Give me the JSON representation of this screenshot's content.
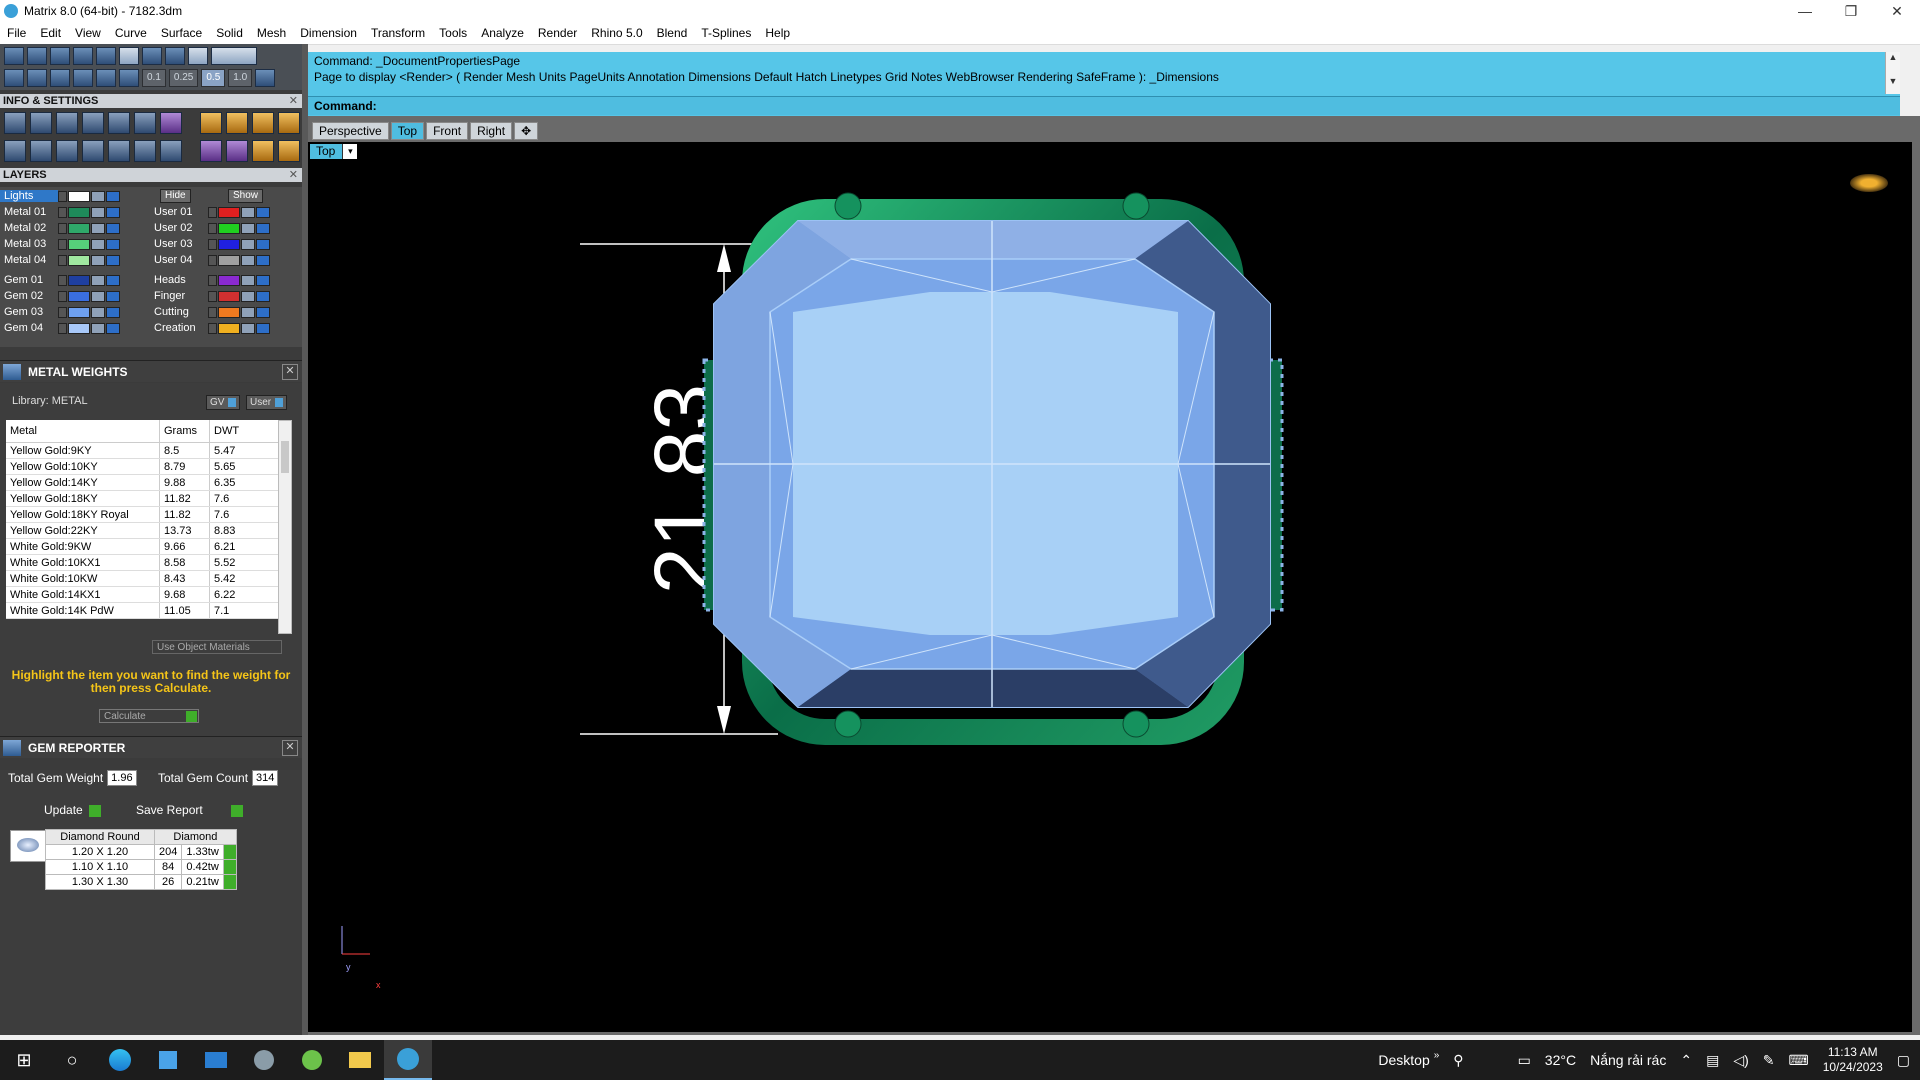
{
  "window": {
    "title": "Matrix 8.0 (64-bit) - 7182.3dm",
    "minimize": "—",
    "maximize": "❐",
    "close": "✕"
  },
  "menu": [
    "File",
    "Edit",
    "View",
    "Curve",
    "Surface",
    "Solid",
    "Mesh",
    "Dimension",
    "Transform",
    "Tools",
    "Analyze",
    "Render",
    "Rhino 5.0",
    "Blend",
    "T-Splines",
    "Help"
  ],
  "toolbar": {
    "snap_values": [
      "0.1",
      "0.25",
      "0.5",
      "1.0"
    ]
  },
  "info_settings": {
    "title": "INFO & SETTINGS",
    "close": "✕"
  },
  "layers": {
    "title": "LAYERS",
    "close": "✕",
    "hide_label": "Hide",
    "show_label": "Show",
    "left": [
      {
        "name": "Lights",
        "color": "#ffffff"
      },
      {
        "name": "Metal 01",
        "color": "#1e8a5a"
      },
      {
        "name": "Metal 02",
        "color": "#2fa86a"
      },
      {
        "name": "Metal 03",
        "color": "#56d07a"
      },
      {
        "name": "Metal 04",
        "color": "#a0e8a0"
      },
      {
        "name": "Gem 01",
        "color": "#1f3fa0"
      },
      {
        "name": "Gem 02",
        "color": "#3a6ee0"
      },
      {
        "name": "Gem 03",
        "color": "#6ea0f0"
      },
      {
        "name": "Gem 04",
        "color": "#a8c8f8"
      }
    ],
    "right": [
      {
        "name": "User 01",
        "color": "#e02020"
      },
      {
        "name": "User 02",
        "color": "#20d020"
      },
      {
        "name": "User 03",
        "color": "#2020e0"
      },
      {
        "name": "User 04",
        "color": "#a0a0a0"
      },
      {
        "name": "Heads",
        "color": "#8a2ad0"
      },
      {
        "name": "Finger",
        "color": "#d03030"
      },
      {
        "name": "Cutting",
        "color": "#f07a20"
      },
      {
        "name": "Creation",
        "color": "#f0b020"
      }
    ]
  },
  "metal_weights": {
    "title": "METAL WEIGHTS",
    "close": "✕",
    "library": "Library: METAL",
    "gv_label": "GV",
    "user_label": "User",
    "columns": [
      "Metal",
      "Grams",
      "DWT"
    ],
    "rows": [
      [
        "Yellow Gold:9KY",
        "8.5",
        "5.47"
      ],
      [
        "Yellow Gold:10KY",
        "8.79",
        "5.65"
      ],
      [
        "Yellow Gold:14KY",
        "9.88",
        "6.35"
      ],
      [
        "Yellow Gold:18KY",
        "11.82",
        "7.6"
      ],
      [
        "Yellow Gold:18KY Royal",
        "11.82",
        "7.6"
      ],
      [
        "Yellow Gold:22KY",
        "13.73",
        "8.83"
      ],
      [
        "White Gold:9KW",
        "9.66",
        "6.21"
      ],
      [
        "White Gold:10KX1",
        "8.58",
        "5.52"
      ],
      [
        "White Gold:10KW",
        "8.43",
        "5.42"
      ],
      [
        "White Gold:14KX1",
        "9.68",
        "6.22"
      ],
      [
        "White Gold:14K PdW",
        "11.05",
        "7.1"
      ]
    ],
    "use_object_materials": "Use Object Materials",
    "hint": "Highlight the item you want to find the weight for then press Calculate.",
    "calculate": "Calculate"
  },
  "gem_reporter": {
    "title": "GEM REPORTER",
    "close": "✕",
    "total_weight_label": "Total Gem Weight",
    "total_weight": "1.96",
    "total_count_label": "Total Gem Count",
    "total_count": "314",
    "update": "Update",
    "save_report": "Save Report",
    "columns": [
      "Diamond Round",
      "Diamond"
    ],
    "rows": [
      [
        "1.20 X 1.20",
        "204",
        "1.33tw"
      ],
      [
        "1.10 X 1.10",
        "84",
        "0.42tw"
      ],
      [
        "1.30 X 1.30",
        "26",
        "0.21tw"
      ]
    ]
  },
  "command": {
    "line1": "Command: _DocumentPropertiesPage",
    "line2": "Page to display <Render> ( Render  Mesh  Units  PageUnits  Annotation  Dimensions  Default  Hatch  Linetypes  Grid  Notes  WebBrowser  Rendering  SafeFrame ): _Dimensions",
    "prompt": "Command:",
    "scroll_up": "▲",
    "scroll_down": "▼"
  },
  "viewport_tabs": [
    "Perspective",
    "Top",
    "Front",
    "Right",
    "✥"
  ],
  "viewport": {
    "label": "Top",
    "dropdown": "▾",
    "dimension": "21.83",
    "axis_y": "y",
    "axis_x": "x"
  },
  "taskbar": {
    "desktop": "Desktop",
    "chevron": "»",
    "temperature": "32°C",
    "weather": "Nắng rải rác",
    "time": "11:13 AM",
    "date": "10/24/2023"
  }
}
